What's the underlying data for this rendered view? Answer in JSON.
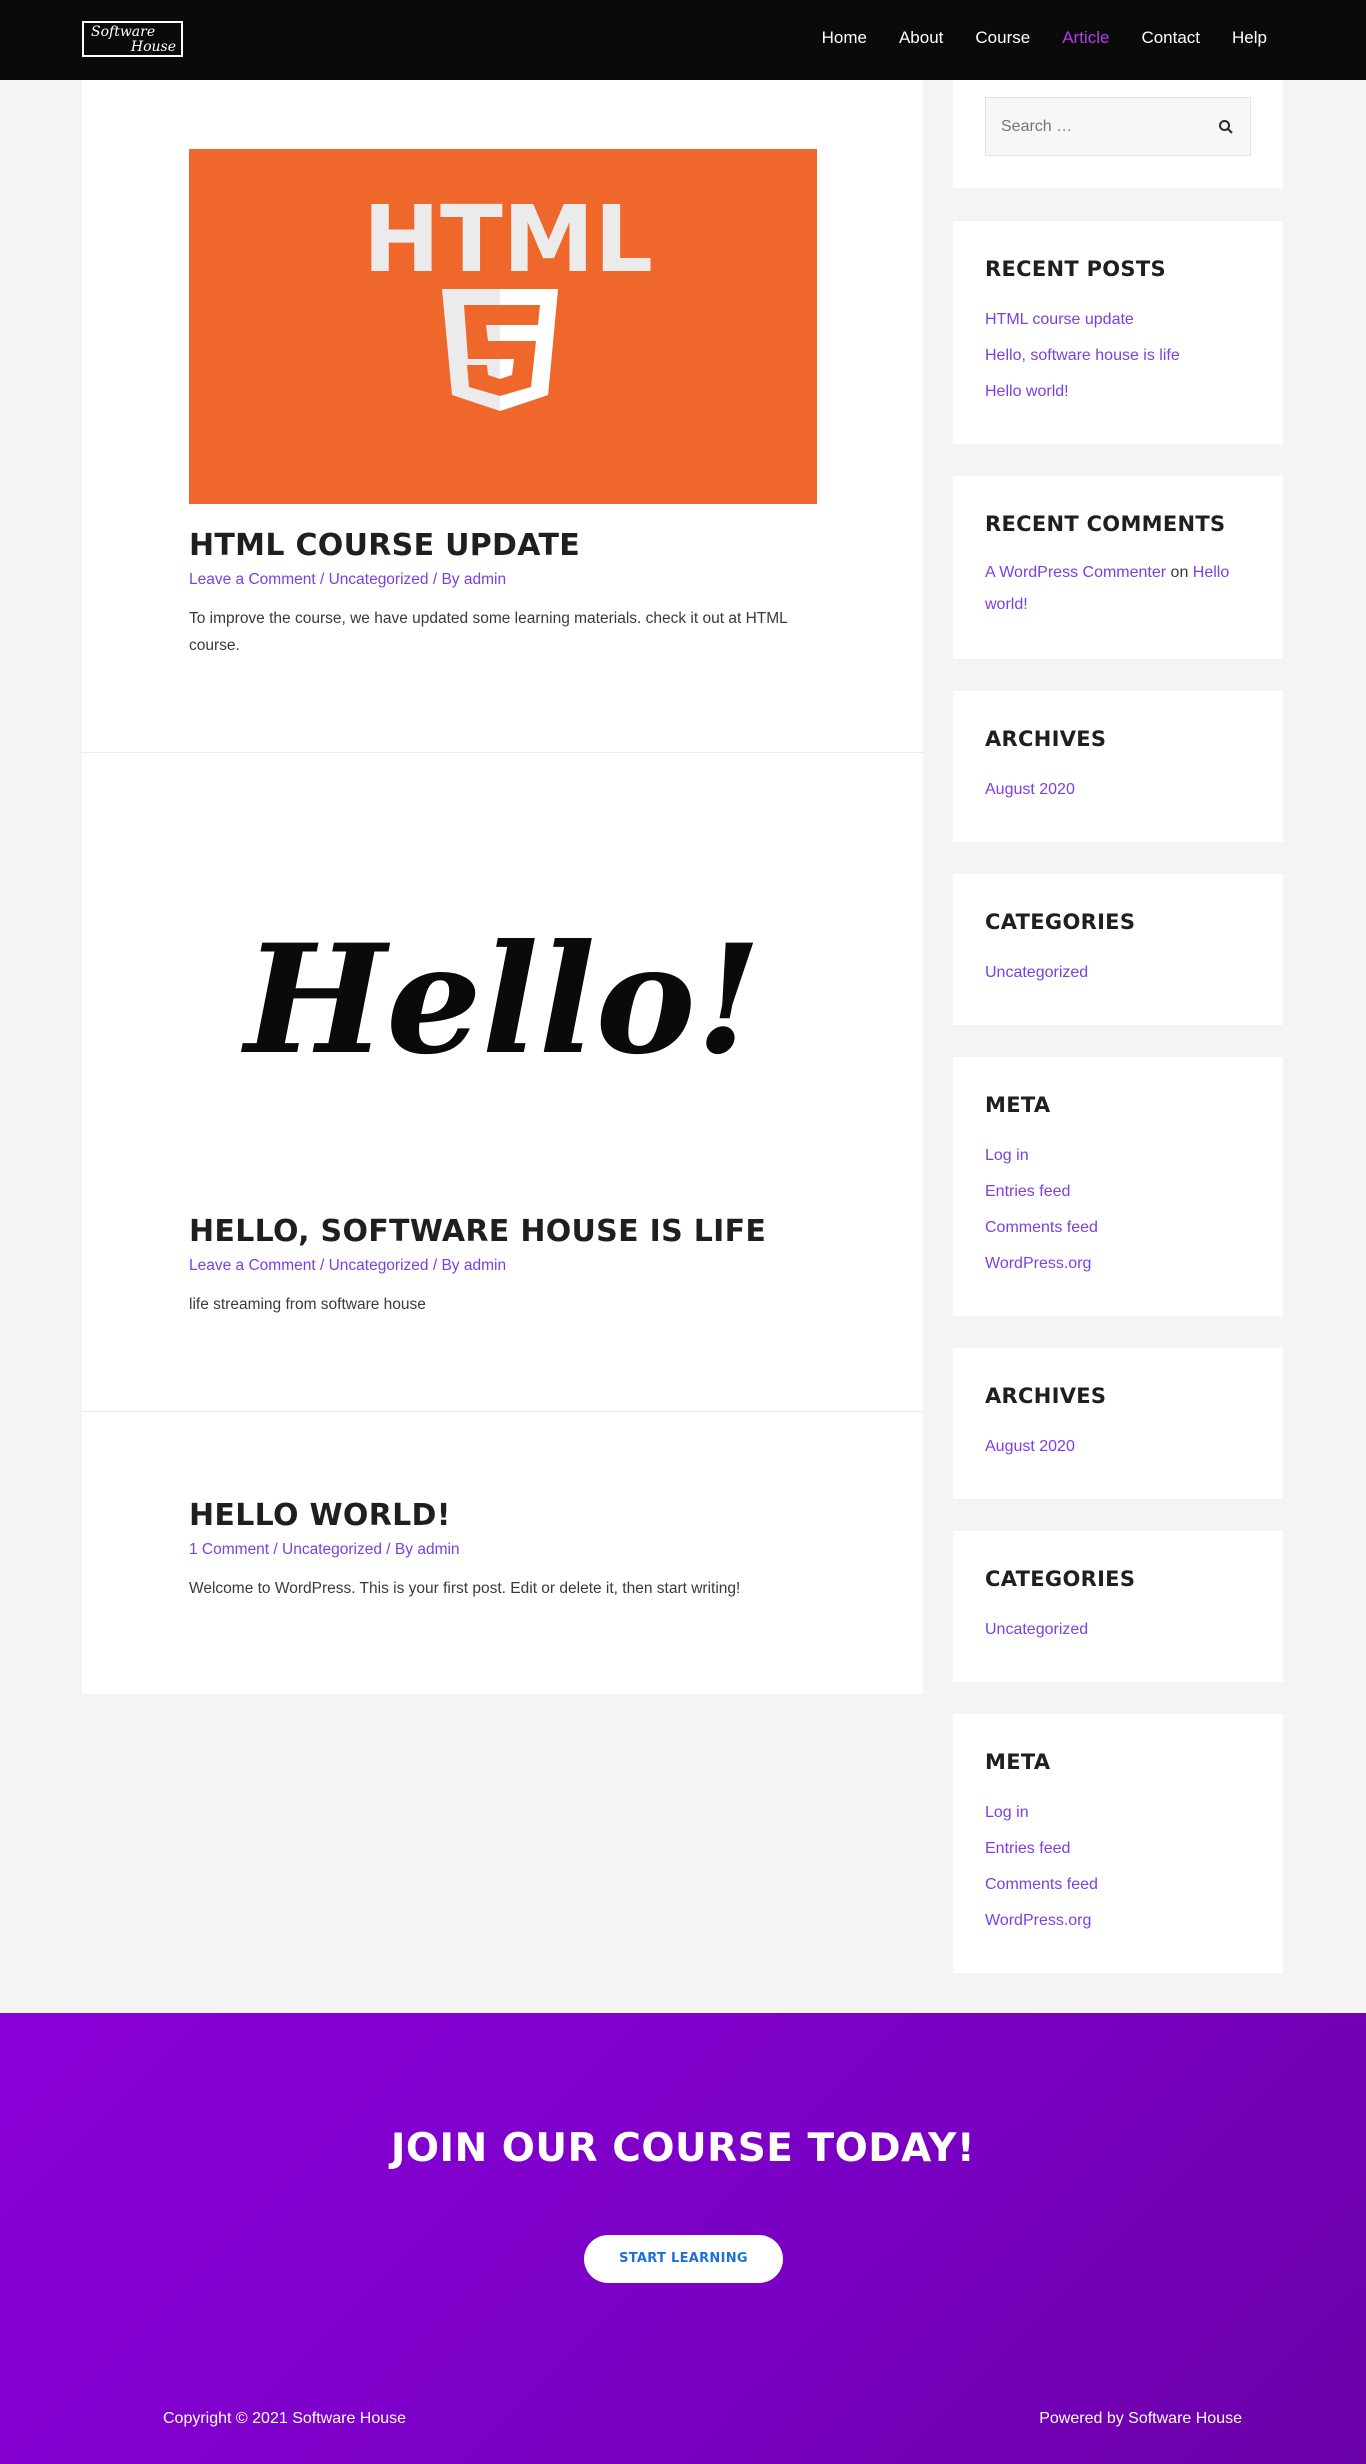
{
  "header": {
    "logo_line1": "Software",
    "logo_line2": "House",
    "nav": [
      "Home",
      "About",
      "Course",
      "Article",
      "Contact",
      "Help"
    ],
    "active_nav": "Article",
    "active_color": "#b33bf0"
  },
  "posts": [
    {
      "image_icon": "html5-logo-image",
      "image_text": "HTML",
      "title": "HTML COURSE UPDATE",
      "comment_link": "Leave a Comment",
      "sep1": " / ",
      "category": "Uncategorized",
      "by": " / By ",
      "author": "admin",
      "excerpt": "To improve the course, we have updated some learning materials. check it out at HTML course."
    },
    {
      "image_icon": "hello-script-image",
      "image_text": "Hello!",
      "title": "HELLO, SOFTWARE HOUSE IS LIFE",
      "comment_link": "Leave a Comment",
      "sep1": " / ",
      "category": "Uncategorized",
      "by": " / By ",
      "author": "admin",
      "excerpt": "life streaming from software house"
    },
    {
      "title": "HELLO WORLD!",
      "comment_link": "1 Comment",
      "sep1": " / ",
      "category": "Uncategorized",
      "by": " / By ",
      "author": "admin",
      "excerpt": "Welcome to WordPress. This is your first post. Edit or delete it, then start writing!"
    }
  ],
  "sidebar": {
    "search_placeholder": "Search …",
    "recent_posts": {
      "title": "RECENT POSTS",
      "items": [
        "HTML course update",
        "Hello, software house is life",
        "Hello world!"
      ]
    },
    "recent_comments": {
      "title": "RECENT COMMENTS",
      "author": "A WordPress Commenter",
      "on": " on ",
      "post": "Hello world!"
    },
    "archives": {
      "title": "ARCHIVES",
      "items": [
        "August 2020"
      ]
    },
    "categories": {
      "title": "CATEGORIES",
      "items": [
        "Uncategorized"
      ]
    },
    "meta": {
      "title": "META",
      "items": [
        "Log in",
        "Entries feed",
        "Comments feed",
        "WordPress.org"
      ]
    }
  },
  "footer": {
    "cta_title": "JOIN OUR COURSE TODAY!",
    "cta_button": "START LEARNING",
    "copyright": "Copyright © 2021 Software House",
    "powered": "Powered by Software House"
  },
  "colors": {
    "link": "#7b3fe4",
    "header_bg": "#0a0a0a",
    "html_orange": "#f0672c",
    "cta_purple": "#8a00d9"
  }
}
